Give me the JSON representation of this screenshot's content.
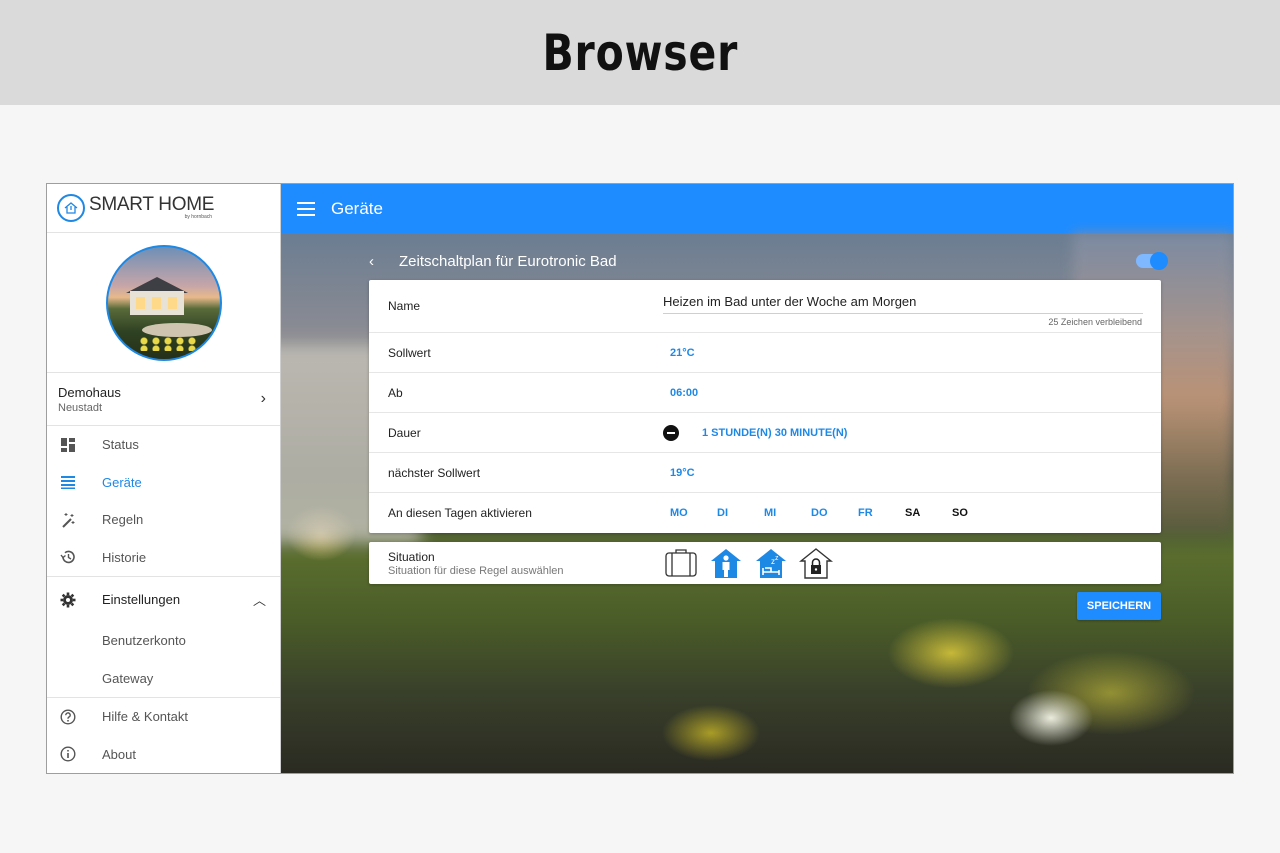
{
  "banner": {
    "title": "Browser"
  },
  "logo": {
    "main": "SMART HOME",
    "sub": "by hornbach"
  },
  "home": {
    "name": "Demohaus",
    "city": "Neustadt"
  },
  "nav": {
    "items": [
      {
        "label": "Status",
        "icon": "dashboard-icon"
      },
      {
        "label": "Geräte",
        "icon": "list-icon",
        "active": true
      },
      {
        "label": "Regeln",
        "icon": "magic-wand-icon"
      },
      {
        "label": "Historie",
        "icon": "history-icon"
      }
    ],
    "settings": {
      "label": "Einstellungen",
      "icon": "gear-icon"
    },
    "settings_sub": [
      "Benutzerkonto",
      "Gateway"
    ],
    "help": {
      "label": "Hilfe & Kontakt",
      "icon": "help-icon"
    },
    "about": {
      "label": "About",
      "icon": "info-icon"
    }
  },
  "appbar": {
    "title": "Geräte"
  },
  "page": {
    "title": "Zeitschaltplan für Eurotronic Bad",
    "enabled": true
  },
  "form": {
    "name_label": "Name",
    "name_value": "Heizen im Bad unter der Woche am Morgen",
    "name_hint": "25 Zeichen verbleibend",
    "sollwert_label": "Sollwert",
    "sollwert_value": "21°C",
    "ab_label": "Ab",
    "ab_value": "06:00",
    "dauer_label": "Dauer",
    "dauer_value": "1 STUNDE(N) 30 MINUTE(N)",
    "next_label": "nächster Sollwert",
    "next_value": "19°C",
    "days_label": "An diesen Tagen aktivieren",
    "days": [
      {
        "label": "MO",
        "active": true
      },
      {
        "label": "DI",
        "active": true
      },
      {
        "label": "MI",
        "active": true
      },
      {
        "label": "DO",
        "active": true
      },
      {
        "label": "FR",
        "active": true
      },
      {
        "label": "SA",
        "active": false
      },
      {
        "label": "SO",
        "active": false
      }
    ]
  },
  "situation": {
    "title": "Situation",
    "subtitle": "Situation für diese Regel auswählen",
    "icons": [
      "suitcase-icon",
      "home-person-icon",
      "sleep-icon",
      "lock-house-icon"
    ]
  },
  "save_label": "SPEICHERN",
  "colors": {
    "accent": "#1e8cff",
    "accent_text": "#1e88e5"
  }
}
